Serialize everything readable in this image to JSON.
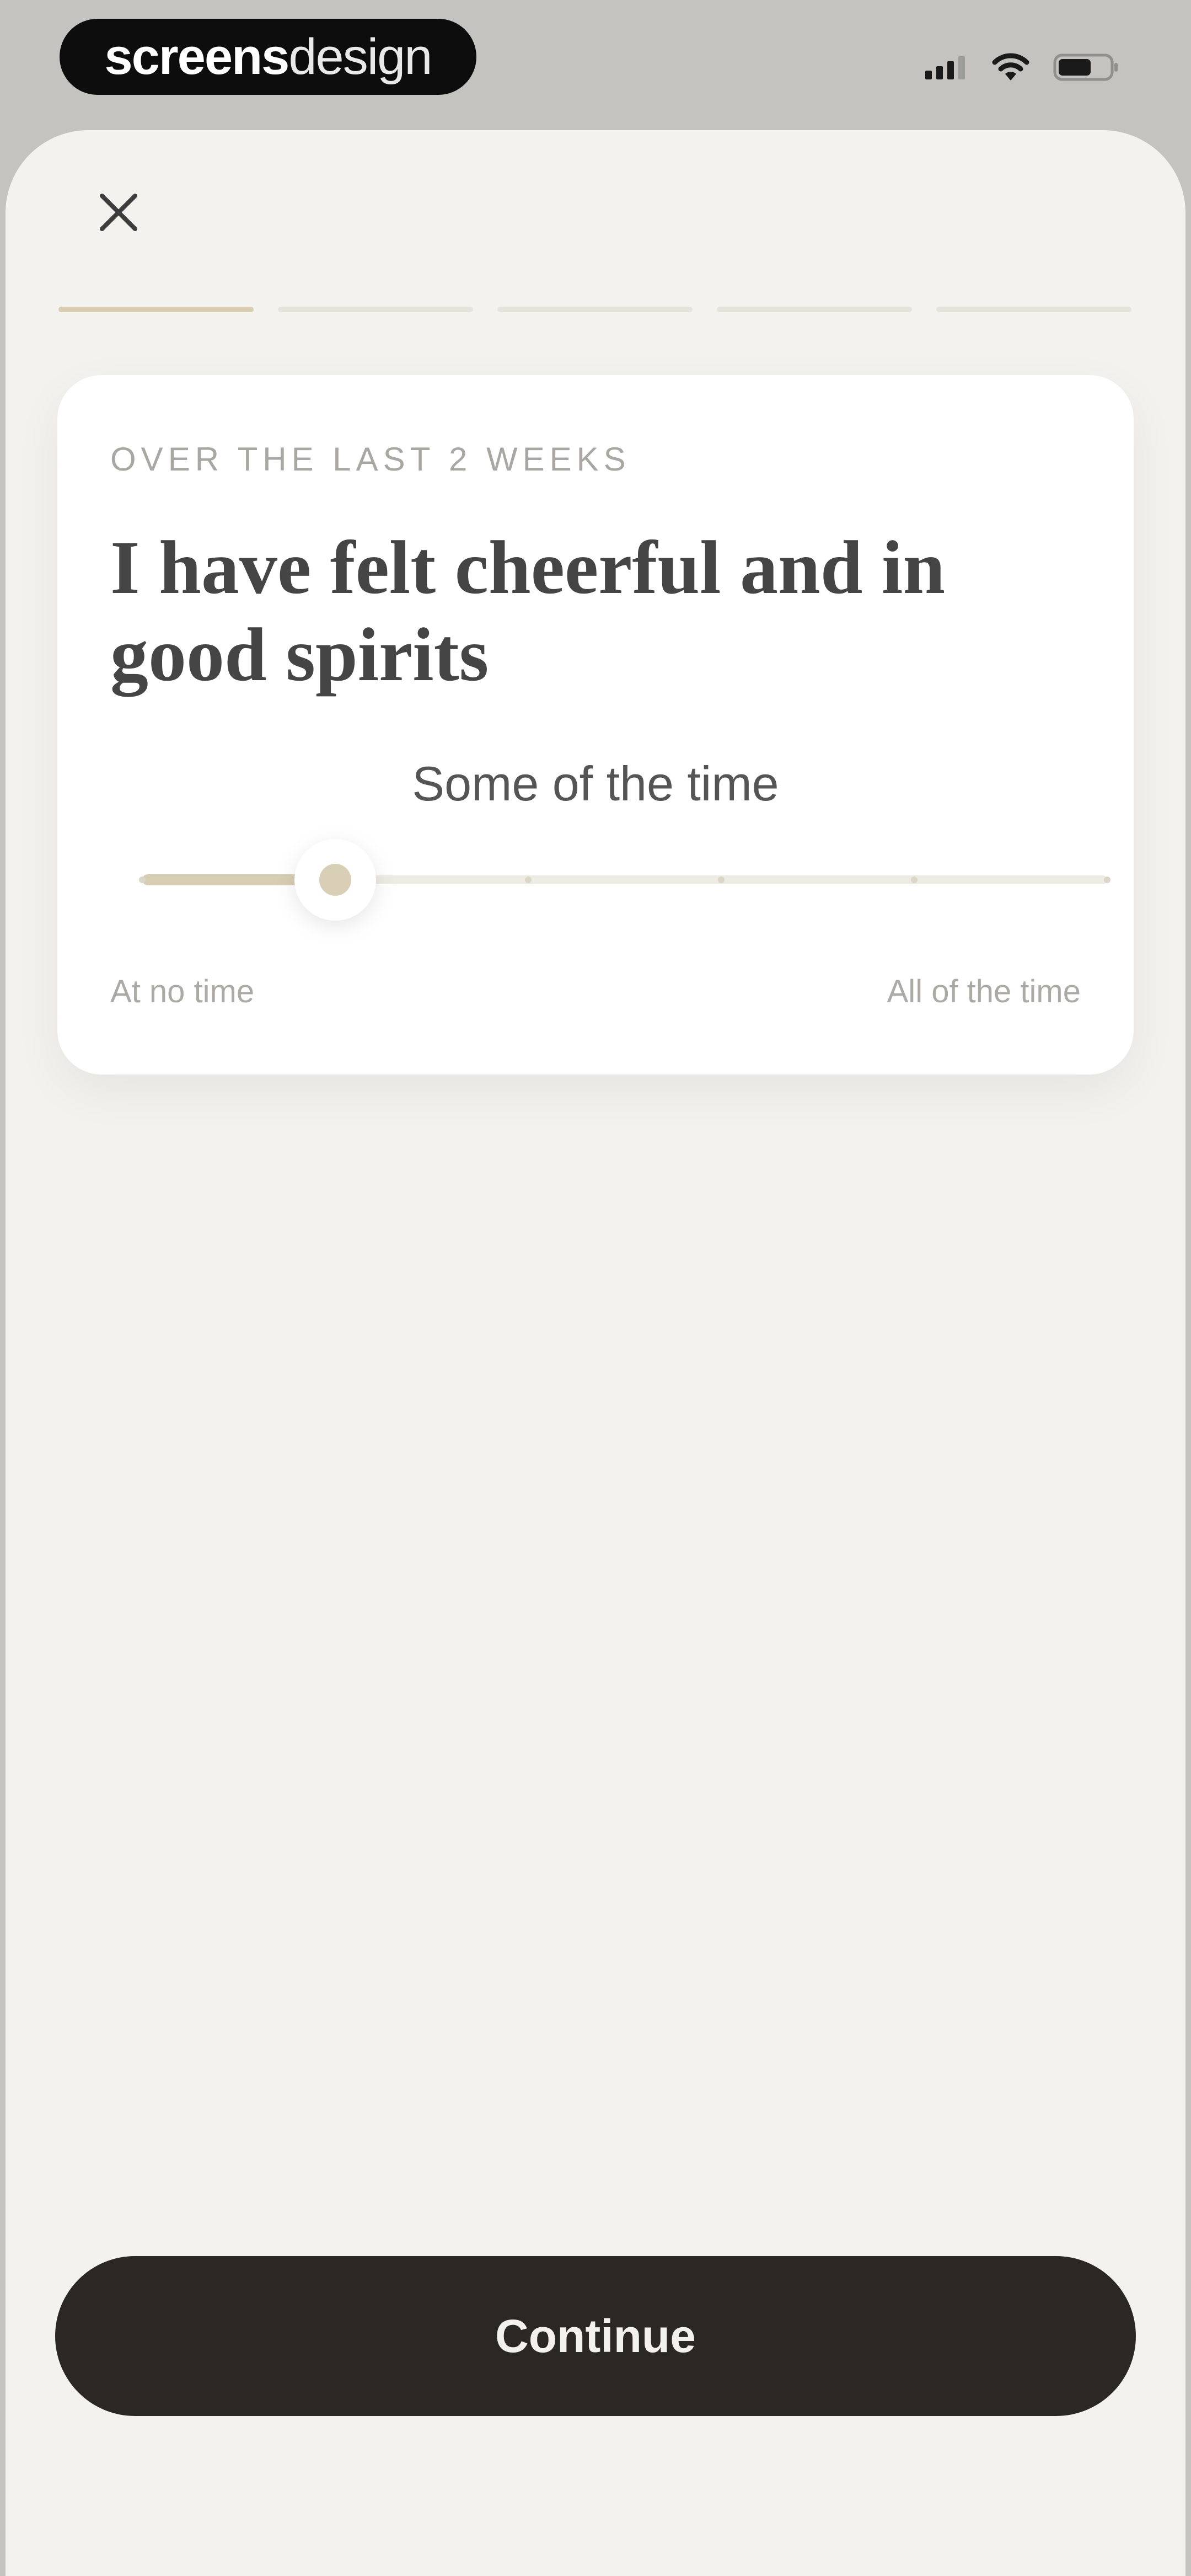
{
  "status_bar": {
    "brand_bold": "screens",
    "brand_light": "design",
    "icons": [
      "cellular-signal-icon",
      "wifi-icon",
      "battery-icon"
    ]
  },
  "header": {
    "close_icon": "close-icon",
    "progress": {
      "total_steps": 5,
      "current_step": 1
    }
  },
  "question_card": {
    "eyebrow": "OVER THE LAST 2 WEEKS",
    "question": "I have felt cheerful and in good spirits",
    "selected_answer": "Some of the time",
    "slider": {
      "steps": 6,
      "selected_index": 1
    },
    "min_label": "At no time",
    "max_label": "All of the time"
  },
  "footer": {
    "continue_label": "Continue"
  },
  "colors": {
    "accent": "#d9cdb1",
    "background": "#f3f2ef",
    "button": "#2a2724"
  }
}
